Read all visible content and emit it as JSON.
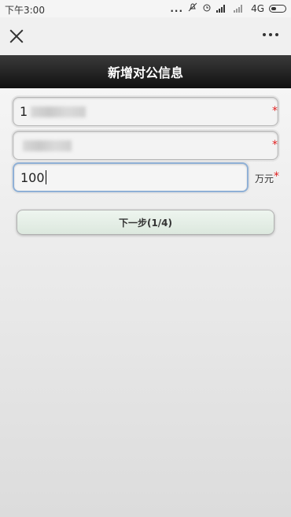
{
  "status": {
    "time": "下午3:00",
    "more": "...",
    "network": "4G"
  },
  "nav": {
    "close_icon": "close-icon",
    "more_icon": "more-icon"
  },
  "title": "新增对公信息",
  "form": {
    "field1_value": "1",
    "field2_value": "",
    "amount_value": "100",
    "amount_unit": "万元",
    "required_mark": "*"
  },
  "next_button": "下一步(1/4)"
}
